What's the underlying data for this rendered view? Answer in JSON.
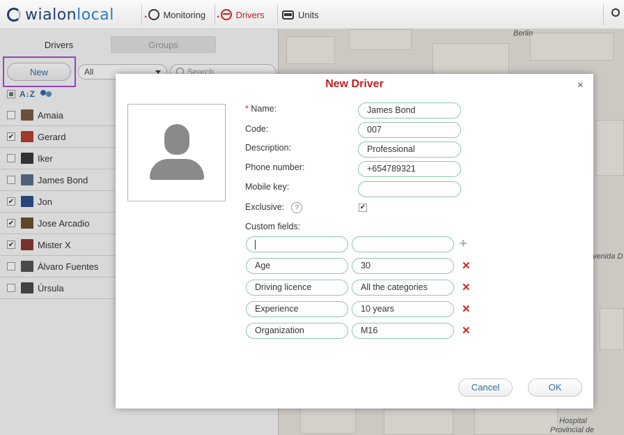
{
  "topbar": {
    "logo_main": "wialon",
    "logo_suffix": "local",
    "nav": [
      {
        "label": "Monitoring"
      },
      {
        "label": "Drivers"
      },
      {
        "label": "Units"
      }
    ]
  },
  "left": {
    "tabs": [
      "Drivers",
      "Groups"
    ],
    "new_label": "New",
    "filter_value": "All",
    "search_placeholder": "Search",
    "drivers": [
      {
        "name": "Amaia",
        "checked": false,
        "color": "#7a5a44"
      },
      {
        "name": "Gerard",
        "checked": true,
        "color": "#b8402e"
      },
      {
        "name": "Iker",
        "checked": false,
        "color": "#3a3a3a"
      },
      {
        "name": "James Bond",
        "checked": false,
        "color": "#5a6f8a"
      },
      {
        "name": "Jon",
        "checked": true,
        "color": "#2d4f8a"
      },
      {
        "name": "Jose Arcadio",
        "checked": true,
        "color": "#6b5030"
      },
      {
        "name": "Mister X",
        "checked": true,
        "color": "#8a3a30"
      },
      {
        "name": "Álvaro Fuentes",
        "checked": false,
        "color": "#555555"
      },
      {
        "name": "Úrsula",
        "checked": false,
        "color": "#4a4a4a"
      }
    ]
  },
  "map": {
    "labels": [
      "Berlin",
      "venida D",
      "Hospital",
      "Provincial de"
    ]
  },
  "dialog": {
    "title": "New Driver",
    "close": "×",
    "fields": {
      "name_label": "Name:",
      "name_value": "James Bond",
      "code_label": "Code:",
      "code_value": "007",
      "description_label": "Description:",
      "description_value": "Professional",
      "phone_label": "Phone number:",
      "phone_value": "+654789321",
      "mobile_label": "Mobile key:",
      "mobile_value": "",
      "exclusive_label": "Exclusive:",
      "exclusive_checked": true,
      "custom_label": "Custom fields:"
    },
    "help_glyph": "?",
    "required_mark": "*",
    "plus_glyph": "+",
    "delete_glyph": "✕",
    "custom_fields": [
      {
        "name": "Age",
        "value": "30"
      },
      {
        "name": "Driving licence",
        "value": "All the categories"
      },
      {
        "name": "Experience",
        "value": "10 years"
      },
      {
        "name": "Organization",
        "value": "M16"
      }
    ],
    "cancel_label": "Cancel",
    "ok_label": "OK"
  }
}
